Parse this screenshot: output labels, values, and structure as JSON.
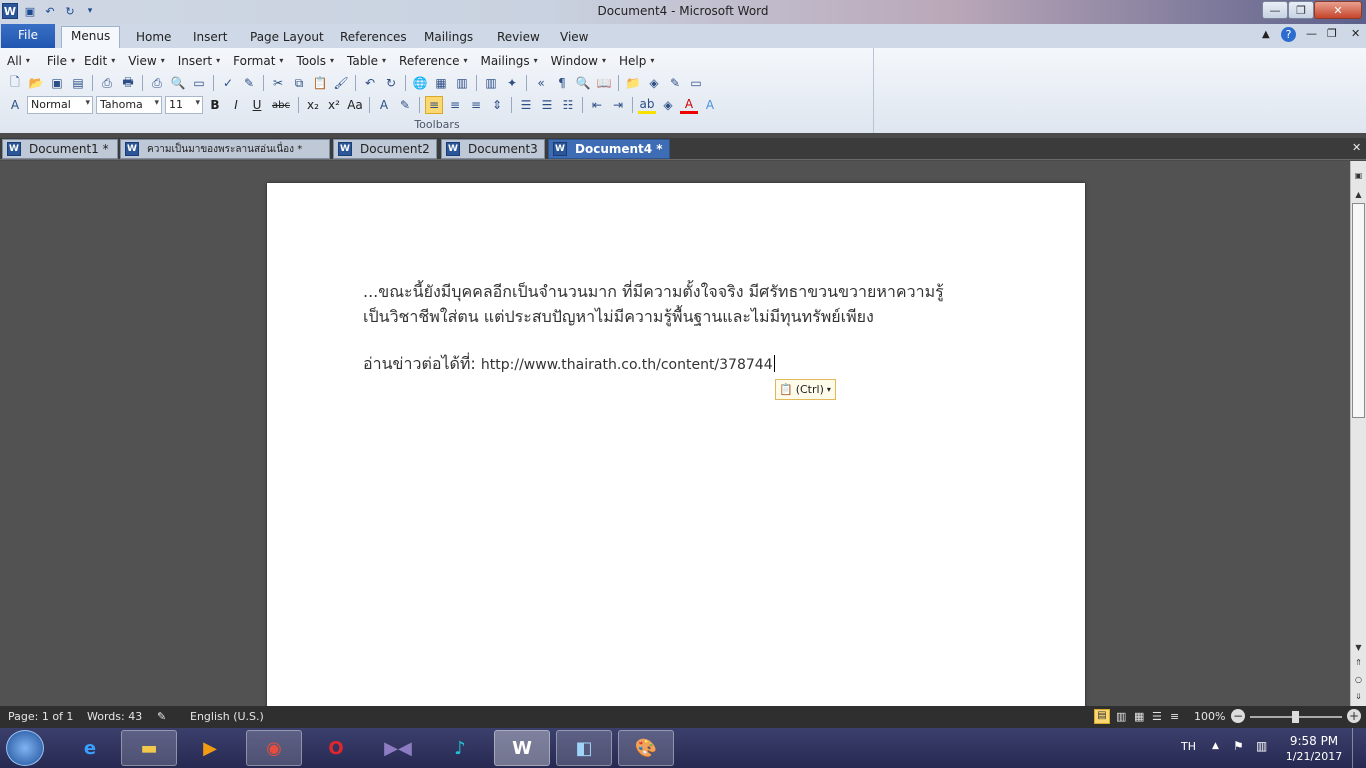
{
  "window": {
    "title": "Document4  -  Microsoft Word",
    "min_label": "—",
    "max_label": "❐",
    "close_label": "✕"
  },
  "ribbon_tabs": [
    "File",
    "Menus",
    "Home",
    "Insert",
    "Page Layout",
    "References",
    "Mailings",
    "Review",
    "View"
  ],
  "menu_bar": [
    "All",
    "File",
    "Edit",
    "View",
    "Insert",
    "Format",
    "Tools",
    "Table",
    "Reference",
    "Mailings",
    "Window",
    "Help"
  ],
  "formatting": {
    "style": "Normal",
    "font": "Tahoma",
    "size": "11",
    "bold": "B",
    "italic": "I",
    "underline": "U",
    "strike": "abc"
  },
  "group_label": "Toolbars",
  "doc_tabs": [
    {
      "label": "Document1  *"
    },
    {
      "label": "ความเป็นมาของพระลานสอ่นเนื่อง  *"
    },
    {
      "label": "Document2"
    },
    {
      "label": "Document3"
    },
    {
      "label": "Document4  *"
    }
  ],
  "document": {
    "line1": "...ขณะนี้ยังมีบุคคลอีกเป็นจำนวนมาก ที่มีความตั้งใจจริง มีศรัทธาขวนขวายหาความรู้",
    "line2": "เป็นวิชาชีพใส่ตน แต่ประสบปัญหาไม่มีความรู้พื้นฐานและไม่มีทุนทรัพย์เพียง",
    "link_label": "อ่านข่าวต่อได้ที่:",
    "link_url": "http://www.thairath.co.th/content/378744",
    "paste_label": "(Ctrl)"
  },
  "status": {
    "page": "Page: 1 of 1",
    "words": "Words: 43",
    "language": "English (U.S.)",
    "zoom": "100%"
  },
  "taskbar": {
    "lang": "TH",
    "time": "9:58 PM",
    "date": "1/21/2017"
  },
  "colors": {
    "accent": "#2b579a",
    "file_tab": "#2b63bd",
    "active_doc_tab": "#3e6db5"
  }
}
